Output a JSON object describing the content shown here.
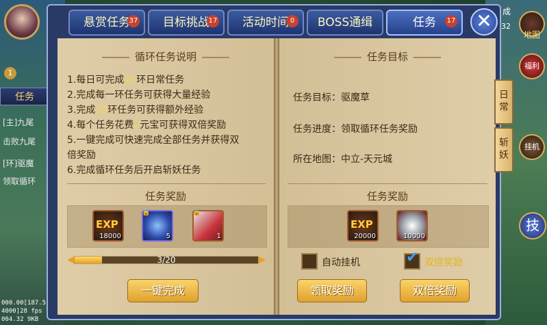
{
  "tabs": [
    {
      "label": "悬赏任务",
      "count": "37"
    },
    {
      "label": "目标挑战",
      "count": "17"
    },
    {
      "label": "活动时间",
      "count": "0"
    },
    {
      "label": "BOSS通缉",
      "count": ""
    },
    {
      "label": "任务",
      "count": "17"
    }
  ],
  "close_label": "✕",
  "left_page": {
    "title": "循环任务说明",
    "lines": [
      {
        "pre": "1.每日可完成",
        "hl": "20",
        "post": "环日常任务"
      },
      {
        "pre": "2.完成每一环任务可获得大量经验",
        "hl": "",
        "post": ""
      },
      {
        "pre": "3.完成",
        "hl": "20",
        "post": "环任务可获得额外经验"
      },
      {
        "pre": "4.每个任务花费",
        "hl": "2",
        "post": "元宝可获得双倍奖励"
      },
      {
        "pre": "5.一键完成可快速完成全部任务并获得双",
        "hl": "",
        "post": ""
      },
      {
        "pre": "倍奖励",
        "hl": "",
        "post": ""
      },
      {
        "pre": "6.完成循环任务后开启斩妖任务",
        "hl": "",
        "post": ""
      }
    ],
    "reward_title": "任务奖励",
    "rewards": [
      {
        "icon": "exp-icon",
        "text": "EXP",
        "count": "18000"
      },
      {
        "icon": "orb-icon",
        "text": "",
        "count": "5"
      },
      {
        "icon": "card-icon",
        "text": "",
        "count": "1"
      }
    ],
    "progress": {
      "text": "3/20",
      "fraction": 0.15
    },
    "one_click_label": "一键完成"
  },
  "right_page": {
    "title": "任务目标",
    "target": "任务目标：驱魔草",
    "progress": "任务进度：领取循环任务奖励",
    "map": "所在地图：中立-天元城",
    "reward_title": "任务奖励",
    "rewards": [
      {
        "icon": "exp-icon",
        "text": "EXP",
        "count": "20000"
      },
      {
        "icon": "silver-ingot-icon",
        "text": "",
        "count": "10000"
      }
    ],
    "auto_label": "自动挂机",
    "double_label": "双倍奖励",
    "claim_label": "领取奖励",
    "double_claim_label": "双倍奖励"
  },
  "side_tabs": [
    {
      "chars": [
        "日",
        "常"
      ]
    },
    {
      "chars": [
        "斩",
        "妖"
      ]
    }
  ],
  "left_hud": {
    "level": "1",
    "task_tab": "任务",
    "lines": [
      "[主]九尾",
      "击败九尾",
      "[环]驱魔",
      "领取循环"
    ],
    "coords": [
      "000.00[187.5",
      "4000]28 fps",
      "004.32 9KB"
    ]
  },
  "right_hud": {
    "cheng": "成",
    "time": "32",
    "map_label": "地图",
    "buttons": [
      "福利",
      "挂机",
      "技"
    ]
  }
}
